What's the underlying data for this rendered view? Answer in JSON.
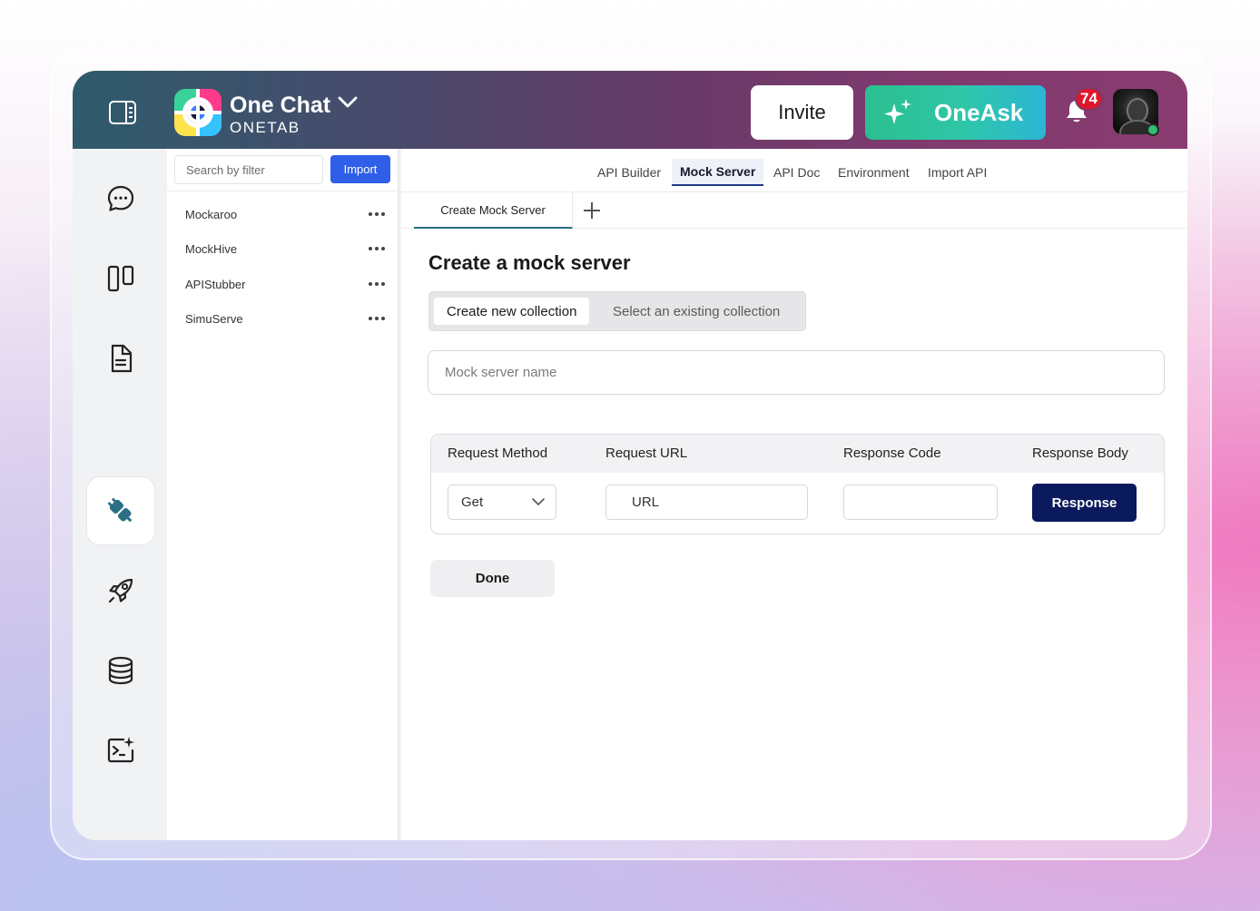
{
  "header": {
    "app_name": "One Chat",
    "app_subtitle": "ONETAB",
    "invite_label": "Invite",
    "oneask_label": "OneAsk",
    "notification_count": "74"
  },
  "colors": {
    "primary_button": "#2f5fe8",
    "response_button": "#0b1a5c",
    "notification_badge": "#e0162b",
    "online_status": "#2fbf71",
    "active_nav_icon": "#2a6f84"
  },
  "sidebar": {
    "items": [
      {
        "icon": "chat-bubble-icon"
      },
      {
        "icon": "columns-icon"
      },
      {
        "icon": "document-icon"
      },
      {
        "icon": "plug-icon",
        "active": true
      },
      {
        "icon": "rocket-icon"
      },
      {
        "icon": "database-icon"
      },
      {
        "icon": "terminal-sparkle-icon"
      },
      {
        "icon": "settings-gear-icon"
      }
    ]
  },
  "list_panel": {
    "search_placeholder": "Search by filter",
    "import_label": "Import",
    "items": [
      {
        "label": "Mockaroo"
      },
      {
        "label": "MockHive"
      },
      {
        "label": "APIStubber"
      },
      {
        "label": "SimuServe"
      }
    ]
  },
  "main": {
    "tabs": [
      {
        "label": "API Builder"
      },
      {
        "label": "Mock Server",
        "active": true
      },
      {
        "label": "API Doc"
      },
      {
        "label": "Environment"
      },
      {
        "label": "Import API"
      }
    ],
    "sub_tab_label": "Create Mock Server",
    "title": "Create a mock server",
    "segment": {
      "option_new": "Create new collection",
      "option_existing": "Select an existing collection"
    },
    "name_placeholder": "Mock server name",
    "table": {
      "headers": [
        "Request Method",
        "Request URL",
        "Response Code",
        "Response Body"
      ],
      "method_value": "Get",
      "url_placeholder": "URL",
      "response_label": "Response"
    },
    "done_label": "Done"
  }
}
